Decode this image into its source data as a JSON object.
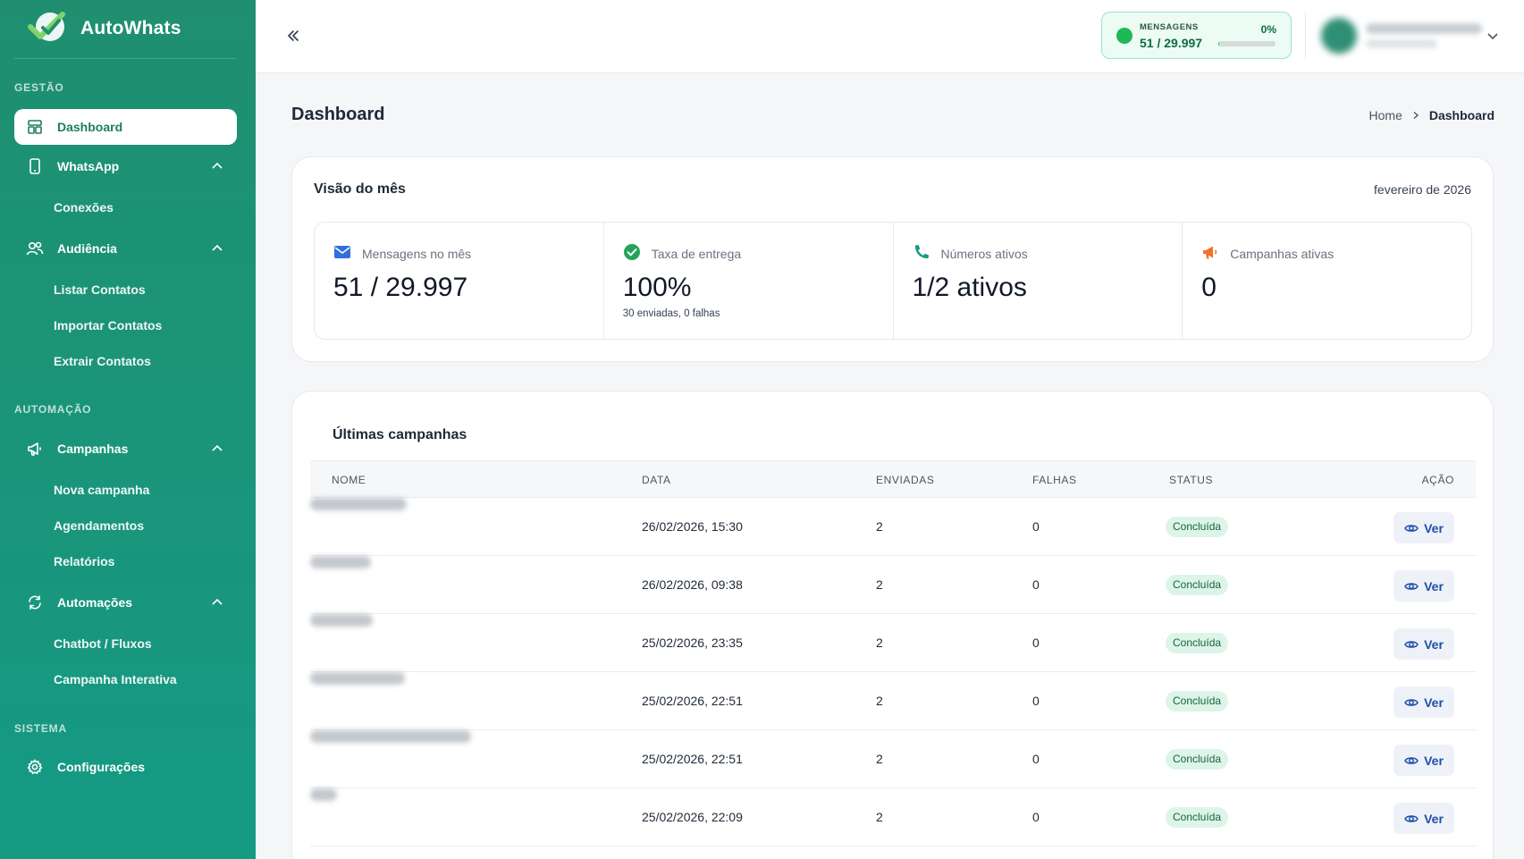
{
  "brand": {
    "name": "AutoWhats"
  },
  "sidebar": {
    "sections": [
      {
        "label": "GESTÃO"
      },
      {
        "label": "AUTOMAÇÃO"
      },
      {
        "label": "SISTEMA"
      }
    ],
    "items": [
      {
        "label": "Dashboard",
        "icon": "dashboard-icon",
        "active": true
      },
      {
        "label": "WhatsApp",
        "icon": "smartphone-icon",
        "children": [
          "Conexões"
        ]
      },
      {
        "label": "Audiência",
        "icon": "users-icon",
        "children": [
          "Listar Contatos",
          "Importar Contatos",
          "Extrair Contatos"
        ]
      },
      {
        "label": "Campanhas",
        "icon": "megaphone-icon",
        "children": [
          "Nova campanha",
          "Agendamentos",
          "Relatórios"
        ]
      },
      {
        "label": "Automações",
        "icon": "refresh-icon",
        "children": [
          "Chatbot / Fluxos",
          "Campanha Interativa"
        ]
      },
      {
        "label": "Configurações",
        "icon": "gear-icon"
      }
    ]
  },
  "topbar": {
    "usage_label": "MENSAGENS",
    "usage_value": "51 / 29.997",
    "usage_percent": "0%",
    "usage_fraction": 0.0017
  },
  "page": {
    "title": "Dashboard",
    "breadcrumb": [
      "Home",
      "Dashboard"
    ]
  },
  "month": {
    "title": "Visão do mês",
    "date": "fevereiro de 2026",
    "stats": [
      {
        "icon": "envelope-icon",
        "label": "Mensagens no mês",
        "value": "51 / 29.997",
        "sub": ""
      },
      {
        "icon": "check-circle-icon",
        "label": "Taxa de entrega",
        "value": "100%",
        "sub": "30 enviadas, 0 falhas"
      },
      {
        "icon": "phone-icon",
        "label": "Números ativos",
        "value": "1/2 ativos",
        "sub": ""
      },
      {
        "icon": "megaphone-icon",
        "label": "Campanhas ativas",
        "value": "0",
        "sub": ""
      }
    ]
  },
  "campaigns": {
    "title": "Últimas campanhas",
    "columns": [
      "NOME",
      "DATA",
      "ENVIADAS",
      "FALHAS",
      "STATUS",
      "AÇÃO"
    ],
    "action_label": "Ver",
    "rows": [
      {
        "data": "26/02/2026, 15:30",
        "enviadas": "2",
        "falhas": "0",
        "status": "Concluída"
      },
      {
        "data": "26/02/2026, 09:38",
        "enviadas": "2",
        "falhas": "0",
        "status": "Concluída"
      },
      {
        "data": "25/02/2026, 23:35",
        "enviadas": "2",
        "falhas": "0",
        "status": "Concluída"
      },
      {
        "data": "25/02/2026, 22:51",
        "enviadas": "2",
        "falhas": "0",
        "status": "Concluída"
      },
      {
        "data": "25/02/2026, 22:51",
        "enviadas": "2",
        "falhas": "0",
        "status": "Concluída"
      },
      {
        "data": "25/02/2026, 22:09",
        "enviadas": "2",
        "falhas": "0",
        "status": "Concluída"
      }
    ]
  }
}
